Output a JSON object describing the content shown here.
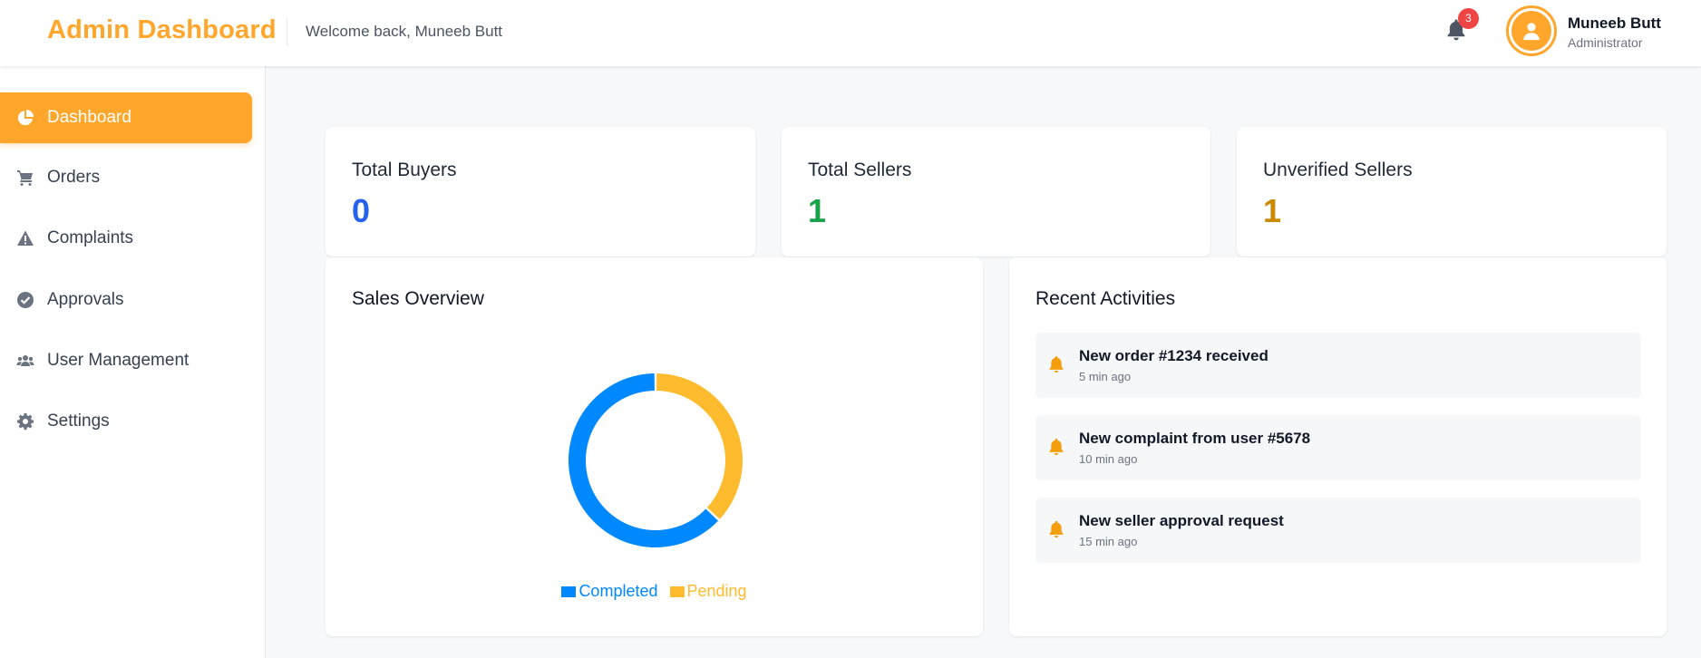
{
  "header": {
    "brand": "Admin Dashboard",
    "welcome": "Welcome back, Muneeb Butt",
    "notifications_count": "3",
    "user_name": "Muneeb Butt",
    "user_role": "Administrator"
  },
  "sidebar": {
    "items": [
      {
        "label": "Dashboard",
        "icon": "pie-chart-icon",
        "active": true
      },
      {
        "label": "Orders",
        "icon": "cart-icon",
        "active": false
      },
      {
        "label": "Complaints",
        "icon": "warning-icon",
        "active": false
      },
      {
        "label": "Approvals",
        "icon": "check-circle-icon",
        "active": false
      },
      {
        "label": "User Management",
        "icon": "users-icon",
        "active": false
      },
      {
        "label": "Settings",
        "icon": "gear-icon",
        "active": false
      }
    ]
  },
  "stats": [
    {
      "title": "Total Buyers",
      "value": "0",
      "color": "#2563eb"
    },
    {
      "title": "Total Sellers",
      "value": "1",
      "color": "#16a34a"
    },
    {
      "title": "Unverified Sellers",
      "value": "1",
      "color": "#ca8a04"
    }
  ],
  "sales": {
    "title": "Sales Overview"
  },
  "chart_data": {
    "type": "pie",
    "categories": [
      "Completed",
      "Pending"
    ],
    "values": [
      63,
      37
    ],
    "colors": [
      "#0088fe",
      "#fdbb2d"
    ],
    "legend": "bottom"
  },
  "activities": {
    "title": "Recent Activities",
    "items": [
      {
        "title": "New order #1234 received",
        "time": "5 min ago"
      },
      {
        "title": "New complaint from user #5678",
        "time": "10 min ago"
      },
      {
        "title": "New seller approval request",
        "time": "15 min ago"
      }
    ]
  },
  "colors": {
    "accent": "#ffa62b",
    "badge": "#ef4444"
  }
}
